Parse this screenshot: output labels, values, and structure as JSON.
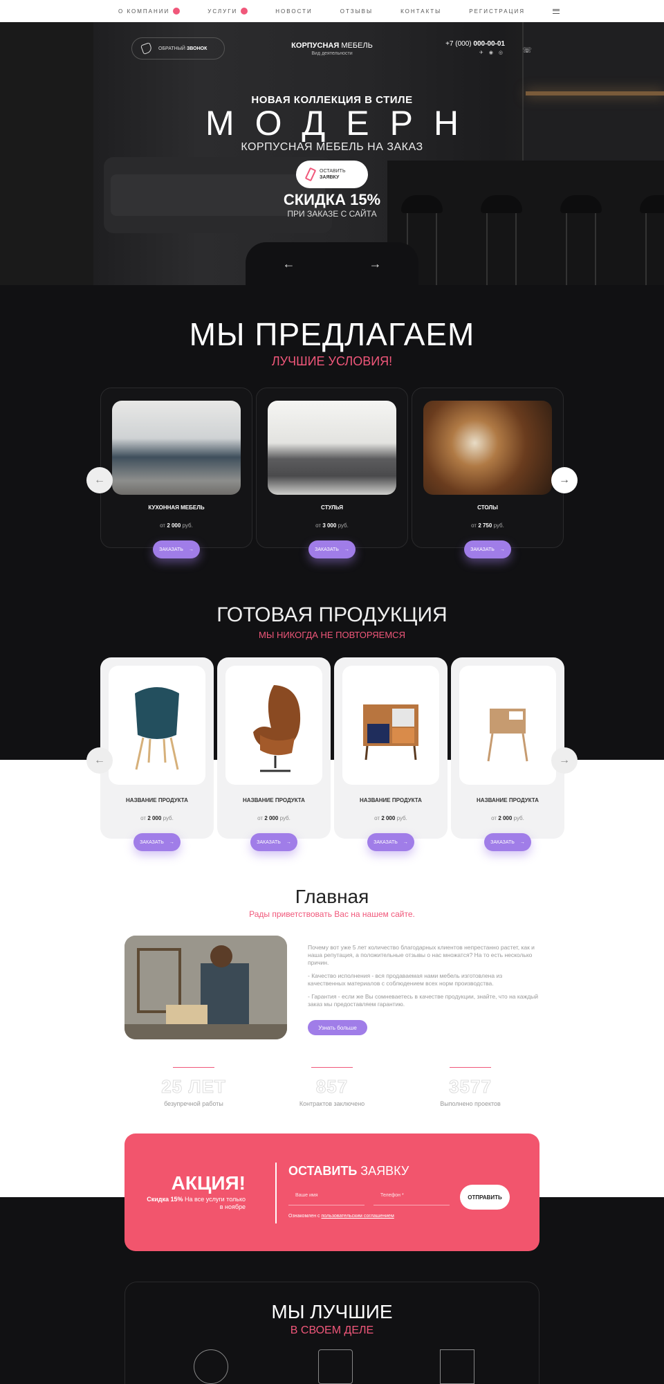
{
  "nav": {
    "items": [
      "О КОМПАНИИ",
      "УСЛУГИ",
      "НОВОСТИ",
      "ОТЗЫВЫ",
      "КОНТАКТЫ",
      "РЕГИСТРАЦИЯ"
    ]
  },
  "header": {
    "callback_pre": "ОБРАТНЫЙ",
    "callback_bold": "ЗВОНОК",
    "brand_bold": "КОРПУСНАЯ",
    "brand_rest": " МЕБЕЛЬ",
    "brand_sub": "Вид деятельности",
    "phone_prefix": "+7 (000) ",
    "phone_main": "000-00-01"
  },
  "hero": {
    "kicker": "НОВАЯ КОЛЛЕКЦИЯ В СТИЛЕ",
    "title": "МОДЕРН",
    "subtitle": "КОРПУСНАЯ МЕБЕЛЬ НА ЗАКАЗ",
    "order_line1": "ОСТАВИТЬ",
    "order_line2": "ЗАЯВКУ",
    "discount": "СКИДКА 15%",
    "discount_sub": "ПРИ ЗАКАЗЕ С САЙТА",
    "prev": "←",
    "next": "→"
  },
  "offers": {
    "title": "МЫ ПРЕДЛАГАЕМ",
    "subtitle": "ЛУЧШИЕ УСЛОВИЯ!",
    "cards": [
      {
        "name": "КУХОННАЯ МЕБЕЛЬ",
        "from": "от",
        "price": "2 000",
        "unit": "руб.",
        "button": "ЗАКАЗАТЬ"
      },
      {
        "name": "СТУЛЬЯ",
        "from": "от",
        "price": "3 000",
        "unit": "руб.",
        "button": "ЗАКАЗАТЬ"
      },
      {
        "name": "СТОЛЫ",
        "from": "от",
        "price": "2 750",
        "unit": "руб.",
        "button": "ЗАКАЗАТЬ"
      }
    ]
  },
  "ready": {
    "title": "ГОТОВАЯ ПРОДУКЦИЯ",
    "subtitle": "МЫ НИКОГДА НЕ ПОВТОРЯЕМСЯ",
    "cards": [
      {
        "name": "НАЗВАНИЕ ПРОДУКТА",
        "from": "от",
        "price": "2 000",
        "unit": "руб.",
        "button": "ЗАКАЗАТЬ"
      },
      {
        "name": "НАЗВАНИЕ ПРОДУКТА",
        "from": "от",
        "price": "2 000",
        "unit": "руб.",
        "button": "ЗАКАЗАТЬ"
      },
      {
        "name": "НАЗВАНИЕ ПРОДУКТА",
        "from": "от",
        "price": "2 000",
        "unit": "руб.",
        "button": "ЗАКАЗАТЬ"
      },
      {
        "name": "НАЗВАНИЕ ПРОДУКТА",
        "from": "от",
        "price": "2 000",
        "unit": "руб.",
        "button": "ЗАКАЗАТЬ"
      }
    ]
  },
  "main": {
    "title": "Главная",
    "subtitle": "Рады приветствовать Вас на нашем сайте.",
    "p1": "Почему вот уже 5 лет количество благодарных клиентов непрестанно растет, как и наша репутация, а положительные отзывы о нас множатся? На то есть несколько причин.",
    "p2": "- Качество исполнения - вся продаваемая нами мебель изготовлена из качественных материалов с соблюдением всех норм производства.",
    "p3": "- Гарантия - если же Вы сомневаетесь в качестве продукции, знайте, что на каждый заказ мы предоставляем гарантию.",
    "more": "Узнать больше",
    "stats": [
      {
        "num": "25 ЛЕТ",
        "label": "безупречной работы"
      },
      {
        "num": "857",
        "label": "Контрактов заключено"
      },
      {
        "num": "3577",
        "label": "Выполнено проектов"
      }
    ]
  },
  "promo": {
    "title": "АКЦИЯ!",
    "sub_bold": "Скидка 15%",
    "sub_rest": " На все услуги только в ноябре",
    "form_bold": "ОСТАВИТЬ",
    "form_rest": " ЗАЯВКУ",
    "name_placeholder": "Ваше имя",
    "phone_placeholder": "Телефон *",
    "send": "ОТПРАВИТЬ",
    "consent_pre": "Ознакомлен с ",
    "consent_link": "пользовательским соглашением"
  },
  "best": {
    "title": "МЫ ЛУЧШИЕ",
    "subtitle": "В СВОЕМ ДЕЛЕ"
  },
  "colors": {
    "accent": "#f0577a",
    "purple": "#a07de8",
    "dark": "#111113"
  }
}
